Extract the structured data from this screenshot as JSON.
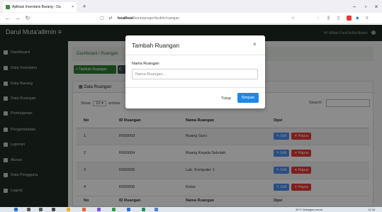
{
  "browser": {
    "tab_title": "Aplikasi Inventaris Barang - Da",
    "url_host": "localhost",
    "url_path": "/barangnegeri/public/ruangan"
  },
  "app": {
    "brand": "Darul Muta'allimin",
    "user": "Hi! Miftah Farid Adhe/Admin"
  },
  "sidebar": {
    "items": [
      {
        "label": "Dashboard",
        "icon": "home-icon"
      },
      {
        "label": "Data Inventaris",
        "icon": "box-icon"
      },
      {
        "label": "Data Barang",
        "icon": "table-icon"
      },
      {
        "label": "Data Ruangan",
        "icon": "table-icon"
      },
      {
        "label": "Peminjaman",
        "icon": "exchange-icon"
      },
      {
        "label": "Pengembalian",
        "icon": "return-icon"
      },
      {
        "label": "Laporan",
        "icon": "print-icon"
      },
      {
        "label": "Aturan",
        "icon": "rules-icon"
      },
      {
        "label": "Data Pengguna",
        "icon": "users-icon"
      },
      {
        "label": "Logout",
        "icon": "power-icon"
      }
    ]
  },
  "main": {
    "breadcrumb": "Dashboard / Ruangan",
    "add_button": "+ Tambah Ruangan",
    "print_button": "C",
    "card_title": "Data Ruangan",
    "show_label": "Show",
    "show_value": "10",
    "entries_label": "entries",
    "search_label": "Search:"
  },
  "table": {
    "headers": [
      "No",
      "ID Ruangan",
      "Nama Ruangan",
      "Opsi"
    ],
    "rows": [
      [
        "1",
        "R000003",
        "Ruang Guru"
      ],
      [
        "2",
        "R000004",
        "Ruang Kepala Sekolah"
      ],
      [
        "3",
        "R000005",
        "Lab. Komputer 1"
      ],
      [
        "4",
        "R000006",
        "Kelas"
      ]
    ],
    "footer": [
      "No",
      "ID Ruangan",
      "Nama Ruangan",
      "Opsi"
    ],
    "edit_label": "Edit",
    "delete_label": "✕ Hapus"
  },
  "modal": {
    "title": "Tambah Ruangan",
    "close": "×",
    "field_label": "Nama Ruangan",
    "field_placeholder": "Nama Ruangan...",
    "field_value": "",
    "cancel": "Tutup",
    "save": "Simpan"
  },
  "taskbar": {
    "weather": "30°C  Sebagian cerah",
    "time": "11:18"
  },
  "colors": {
    "sidebar": "#1f2b22",
    "primary": "#1e88e5",
    "success": "#2e7d32",
    "danger": "#e53935"
  }
}
